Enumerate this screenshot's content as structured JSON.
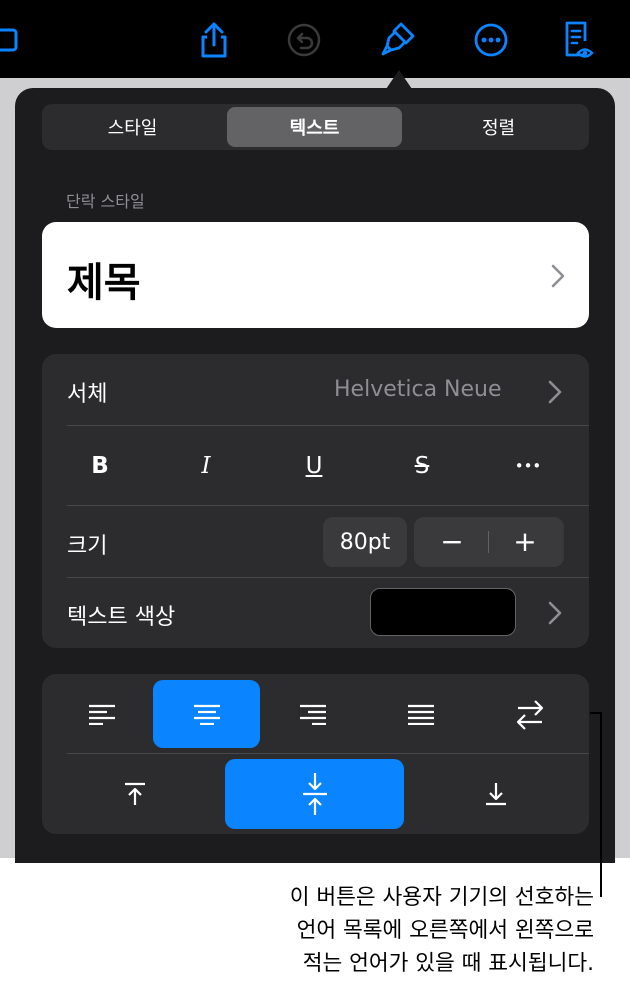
{
  "toolbar": {
    "icons": [
      "media-icon",
      "share-icon",
      "undo-icon",
      "format-brush-icon",
      "more-icon",
      "reader-view-icon"
    ],
    "accent": "#0a84ff"
  },
  "segments": {
    "items": [
      "스타일",
      "텍스트",
      "정렬"
    ],
    "selected": "텍스트"
  },
  "paragraph_style": {
    "label": "단락 스타일",
    "value": "제목"
  },
  "font": {
    "label": "서체",
    "value": "Helvetica Neue",
    "styles": [
      "B",
      "I",
      "U",
      "S",
      "•••"
    ]
  },
  "size": {
    "label": "크기",
    "value": "80pt",
    "minus": "−",
    "plus": "+"
  },
  "text_color": {
    "label": "텍스트 색상",
    "swatch": "#000000"
  },
  "alignment": {
    "horizontal": [
      "align-left",
      "align-center",
      "align-right",
      "justify",
      "right-to-left"
    ],
    "horizontal_selected": "align-center",
    "vertical": [
      "align-top",
      "align-middle",
      "align-bottom"
    ],
    "vertical_selected": "align-middle"
  },
  "callout": {
    "lines": [
      "이 버튼은 사용자 기기의 선호하는",
      "언어 목록에 오른쪽에서 왼쪽으로",
      "적는 언어가 있을 때 표시됩니다."
    ]
  }
}
